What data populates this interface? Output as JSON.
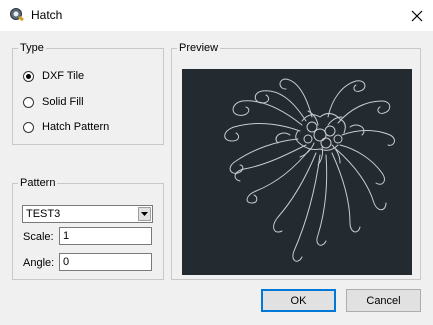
{
  "window": {
    "title": "Hatch",
    "icon": "app-icon",
    "close_icon": "close-icon"
  },
  "type_group": {
    "label": "Type",
    "options": [
      {
        "label": "DXF Tile",
        "checked": true
      },
      {
        "label": "Solid Fill",
        "checked": false
      },
      {
        "label": "Hatch Pattern",
        "checked": false
      }
    ]
  },
  "pattern_group": {
    "label": "Pattern",
    "selected_pattern": "TEST3",
    "scale_label": "Scale:",
    "scale_value": "1",
    "angle_label": "Angle:",
    "angle_value": "0"
  },
  "preview_group": {
    "label": "Preview",
    "background": "#232a30",
    "stroke": "#c8ccd0"
  },
  "buttons": {
    "ok": "OK",
    "cancel": "Cancel"
  }
}
